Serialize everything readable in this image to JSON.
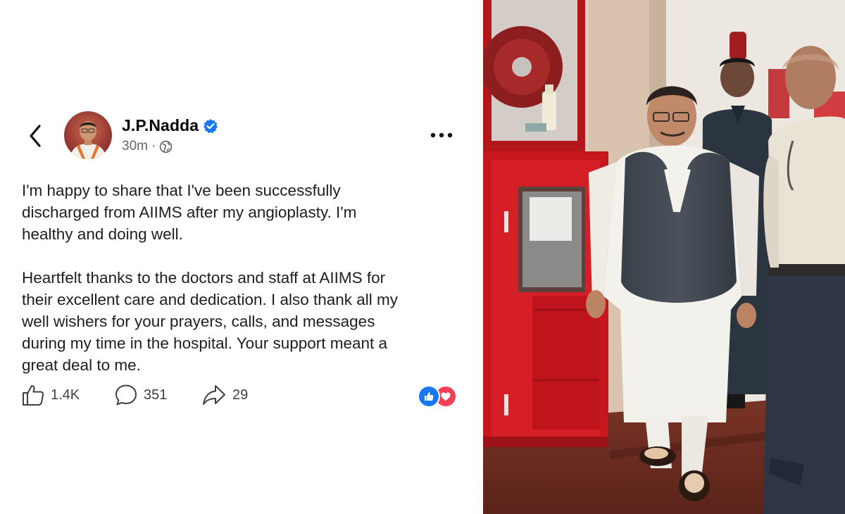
{
  "post": {
    "author": "J.P.Nadda",
    "time": "30m",
    "separator": "·",
    "icons": {
      "back": "chevron-left-icon",
      "verified": "verified-badge-icon",
      "audience": "globe-icon",
      "more": "more-horizontal-icon",
      "like": "thumbs-up-icon",
      "comment": "comment-bubble-icon",
      "share": "share-arrow-icon",
      "reaction_like": "like-reaction-icon",
      "reaction_love": "love-reaction-icon"
    },
    "paragraphs": [
      "I'm happy to share that I've been successfully\ndischarged from AIIMS after my angioplasty. I'm\nhealthy and doing well.",
      "Heartfelt thanks to the doctors and staff at AIIMS for\ntheir excellent care and dedication. I also thank all my\nwell wishers for your prayers, calls, and messages\nduring my time in the hospital. Your support meant a\ngreat deal to me."
    ],
    "stats": {
      "likes": "1.4K",
      "comments": "351",
      "shares": "29"
    }
  },
  "colors": {
    "verified_blue": "#1877f2",
    "text_primary": "#1c1e21",
    "text_secondary": "#65676b",
    "like_blue": "#1877f2",
    "love_red": "#f33e58"
  }
}
